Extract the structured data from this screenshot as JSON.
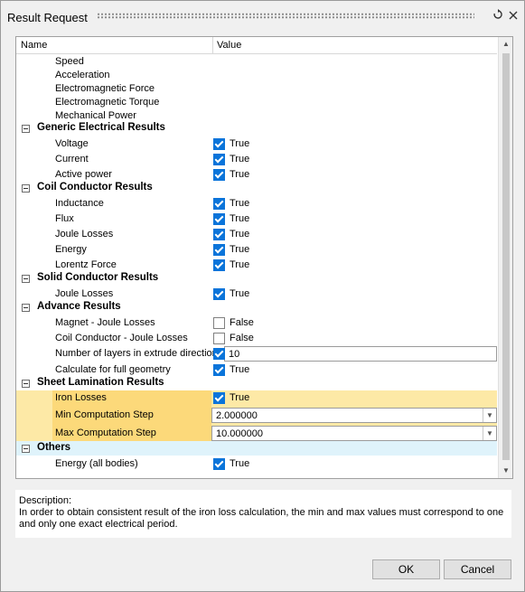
{
  "window": {
    "title": "Result Request"
  },
  "titlebar": {
    "refresh_icon": "refresh-icon",
    "close_icon": "close-icon"
  },
  "grid": {
    "columns": [
      "Name",
      "Value"
    ],
    "rows": [
      {
        "type": "item",
        "name": "Speed"
      },
      {
        "type": "item",
        "name": "Acceleration"
      },
      {
        "type": "item",
        "name": "Electromagnetic Force"
      },
      {
        "type": "item",
        "name": "Electromagnetic Torque"
      },
      {
        "type": "item",
        "name": "Mechanical Power"
      },
      {
        "type": "group",
        "name": "Generic Electrical Results"
      },
      {
        "type": "check",
        "name": "Voltage",
        "checked": true,
        "value": "True"
      },
      {
        "type": "check",
        "name": "Current",
        "checked": true,
        "value": "True"
      },
      {
        "type": "check",
        "name": "Active power",
        "checked": true,
        "value": "True"
      },
      {
        "type": "group",
        "name": "Coil Conductor Results"
      },
      {
        "type": "check",
        "name": "Inductance",
        "checked": true,
        "value": "True"
      },
      {
        "type": "check",
        "name": "Flux",
        "checked": true,
        "value": "True"
      },
      {
        "type": "check",
        "name": "Joule Losses",
        "checked": true,
        "value": "True"
      },
      {
        "type": "check",
        "name": "Energy",
        "checked": true,
        "value": "True"
      },
      {
        "type": "check",
        "name": "Lorentz Force",
        "checked": true,
        "value": "True"
      },
      {
        "type": "group",
        "name": "Solid Conductor Results"
      },
      {
        "type": "check",
        "name": "Joule Losses",
        "checked": true,
        "value": "True"
      },
      {
        "type": "group",
        "name": "Advance Results"
      },
      {
        "type": "check",
        "name": "Magnet - Joule Losses",
        "checked": false,
        "value": "False"
      },
      {
        "type": "check",
        "name": "Coil Conductor - Joule Losses",
        "checked": false,
        "value": "False"
      },
      {
        "type": "checkinput",
        "name": "Number of layers in extrude direction",
        "checked": true,
        "value": "10"
      },
      {
        "type": "check",
        "name": "Calculate for full geometry",
        "checked": true,
        "value": "True"
      },
      {
        "type": "group",
        "name": "Sheet Lamination Results"
      },
      {
        "type": "check",
        "name": "Iron Losses",
        "checked": true,
        "value": "True",
        "highlight": true
      },
      {
        "type": "dropdown",
        "name": "Min Computation Step",
        "value": "2.000000",
        "highlight": true
      },
      {
        "type": "dropdown",
        "name": "Max Computation Step",
        "value": "10.000000",
        "highlight": true
      },
      {
        "type": "group",
        "name": "Others",
        "selected": true
      },
      {
        "type": "check",
        "name": "Energy (all bodies)",
        "checked": true,
        "value": "True"
      }
    ]
  },
  "description": {
    "label": "Description:",
    "text": "In order to obtain consistent result of the iron loss calculation, the min and max values must correspond to one and only one exact electrical period."
  },
  "buttons": {
    "ok": "OK",
    "cancel": "Cancel"
  },
  "colors": {
    "highlight_value": "#fde9a6",
    "highlight_name": "#fcd97a",
    "selected_group": "#dff3fb",
    "checkbox": "#0a74da"
  }
}
